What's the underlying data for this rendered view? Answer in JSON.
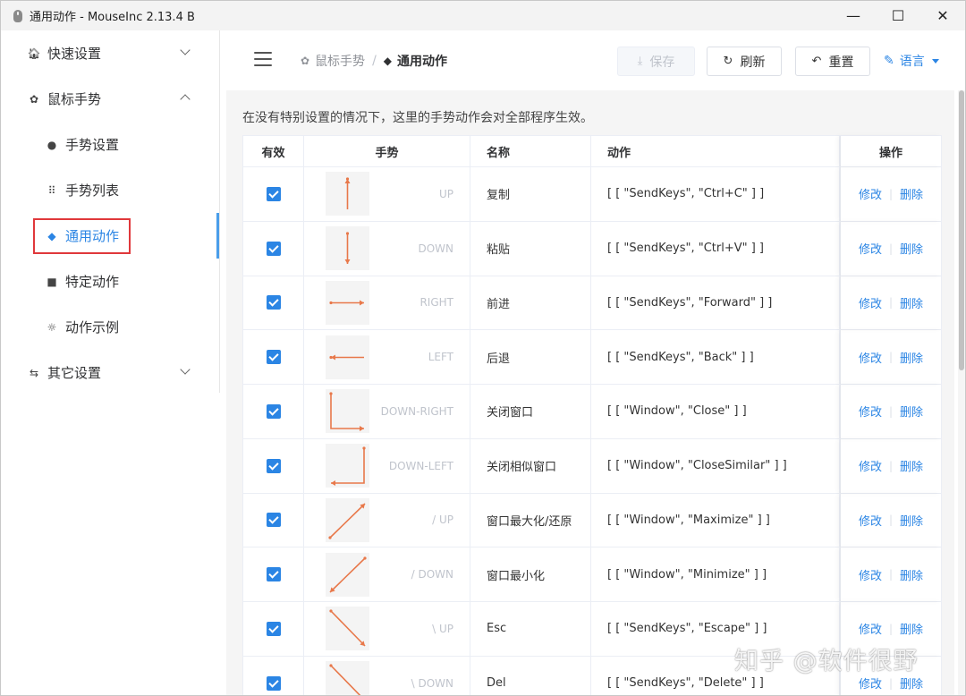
{
  "window": {
    "title": "通用动作 - MouseInc 2.13.4 B",
    "controls": [
      "—",
      "☐",
      "✕"
    ]
  },
  "sidebar": {
    "items": [
      {
        "label": "快速设置",
        "icon": "home-icon",
        "level": 1,
        "expand": "down"
      },
      {
        "label": "鼠标手势",
        "icon": "gear-icon",
        "level": 1,
        "expand": "up"
      },
      {
        "label": "手势设置",
        "icon": "palette-icon",
        "level": 2
      },
      {
        "label": "手势列表",
        "icon": "grid-icon",
        "level": 2
      },
      {
        "label": "通用动作",
        "icon": "cube-icon",
        "level": 2,
        "active": true
      },
      {
        "label": "特定动作",
        "icon": "briefcase-icon",
        "level": 2
      },
      {
        "label": "动作示例",
        "icon": "sun-icon",
        "level": 2
      },
      {
        "label": "其它设置",
        "icon": "sliders-icon",
        "level": 1,
        "expand": "down"
      }
    ]
  },
  "header": {
    "breadcrumb": [
      {
        "label": "鼠标手势",
        "icon": "gear-icon"
      },
      {
        "label": "通用动作",
        "icon": "cube-icon"
      }
    ],
    "breadcrumb_sep": "/",
    "save_label": "保存",
    "refresh_label": "刷新",
    "reset_label": "重置",
    "language_label": "语言"
  },
  "description": "在没有特别设置的情况下，这里的手势动作会对全部程序生效。",
  "table": {
    "headers": {
      "valid": "有效",
      "gesture": "手势",
      "name": "名称",
      "action": "动作",
      "ops": "操作"
    },
    "edit_label": "修改",
    "delete_label": "删除",
    "op_sep": "|",
    "rows": [
      {
        "checked": true,
        "gesture": "UP",
        "stroke": "up",
        "name": "复制",
        "action": "[ [ \"SendKeys\", \"Ctrl+C\" ] ]"
      },
      {
        "checked": true,
        "gesture": "DOWN",
        "stroke": "down",
        "name": "粘贴",
        "action": "[ [ \"SendKeys\", \"Ctrl+V\" ] ]"
      },
      {
        "checked": true,
        "gesture": "RIGHT",
        "stroke": "right",
        "name": "前进",
        "action": "[ [ \"SendKeys\", \"Forward\" ] ]"
      },
      {
        "checked": true,
        "gesture": "LEFT",
        "stroke": "left",
        "name": "后退",
        "action": "[ [ \"SendKeys\", \"Back\" ] ]"
      },
      {
        "checked": true,
        "gesture": "DOWN-RIGHT",
        "stroke": "down-right",
        "name": "关闭窗口",
        "action": "[ [ \"Window\", \"Close\" ] ]"
      },
      {
        "checked": true,
        "gesture": "DOWN-LEFT",
        "stroke": "down-left",
        "name": "关闭相似窗口",
        "action": "[ [ \"Window\", \"CloseSimilar\" ] ]"
      },
      {
        "checked": true,
        "gesture": "/ UP",
        "stroke": "diag-up-right",
        "name": "窗口最大化/还原",
        "action": "[ [ \"Window\", \"Maximize\" ] ]"
      },
      {
        "checked": true,
        "gesture": "/ DOWN",
        "stroke": "diag-down-left",
        "name": "窗口最小化",
        "action": "[ [ \"Window\", \"Minimize\" ] ]"
      },
      {
        "checked": true,
        "gesture": "\\ UP",
        "stroke": "diag-up-left",
        "name": "Esc",
        "action": "[ [ \"SendKeys\", \"Escape\" ] ]"
      },
      {
        "checked": true,
        "gesture": "\\ DOWN",
        "stroke": "diag-down-right",
        "name": "Del",
        "action": "[ [ \"SendKeys\", \"Delete\" ] ]"
      }
    ]
  },
  "watermark": "知乎 @软件很野",
  "colors": {
    "accent": "#2b85e4",
    "stroke": "#e8784a",
    "highlight": "#e0383b"
  }
}
